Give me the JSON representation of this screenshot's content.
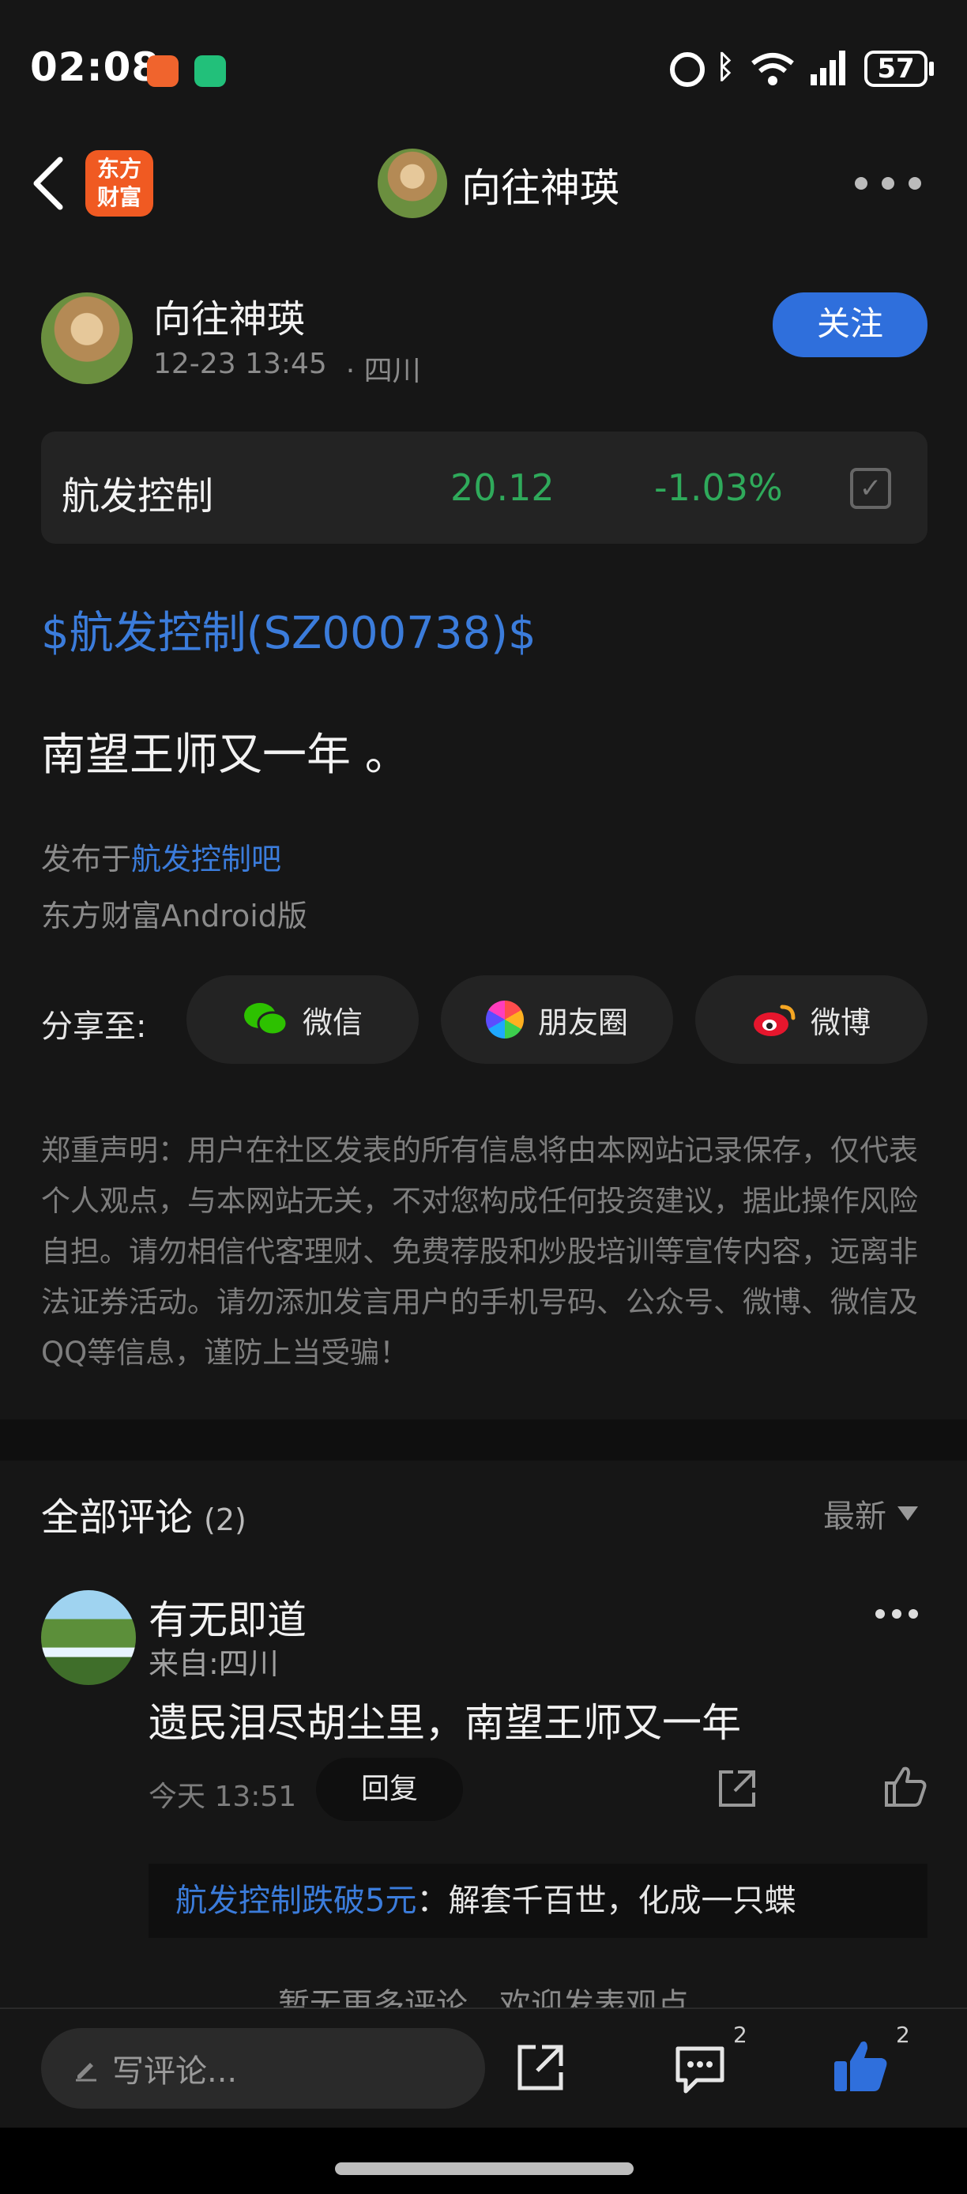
{
  "status": {
    "time": "02:08",
    "battery": "57",
    "accent": "#2f6fdc"
  },
  "header": {
    "app_logo_line1": "东方",
    "app_logo_line2": "财富",
    "title": "向往神瑛"
  },
  "post": {
    "author": "向往神瑛",
    "time": "12-23 13:45",
    "location": "· 四川",
    "follow_label": "关注",
    "stock": {
      "name": "航发控制",
      "price": "20.12",
      "change": "-1.03%"
    },
    "cashtag": "$航发控制(SZ000738)$",
    "content": "南望王师又一年 。",
    "published_prefix": "发布于",
    "published_board": "航发控制吧",
    "client": "东方财富Android版"
  },
  "share": {
    "label": "分享至:",
    "wechat": "微信",
    "moments": "朋友圈",
    "weibo": "微博"
  },
  "disclaimer": "郑重声明：用户在社区发表的所有信息将由本网站记录保存，仅代表个人观点，与本网站无关，不对您构成任何投资建议，据此操作风险自担。请勿相信代客理财、免费荐股和炒股培训等宣传内容，远离非法证券活动。请勿添加发言用户的手机号码、公众号、微博、微信及QQ等信息，谨防上当受骗！",
  "comments": {
    "title": "全部评论",
    "count": "(2)",
    "sort": "最新",
    "items": [
      {
        "user": "有无即道",
        "from": "来自:四川",
        "text": "遗民泪尽胡尘里，南望王师又一年",
        "time": "今天 13:51",
        "reply_label": "回复",
        "sub_reply_user": "航发控制跌破5元",
        "sub_reply_text": "：解套千百世，化成一只蝶"
      }
    ],
    "no_more": "暂无更多评论，欢迎发表观点"
  },
  "bottom": {
    "placeholder": "写评论...",
    "comment_count": "2",
    "like_count": "2"
  }
}
